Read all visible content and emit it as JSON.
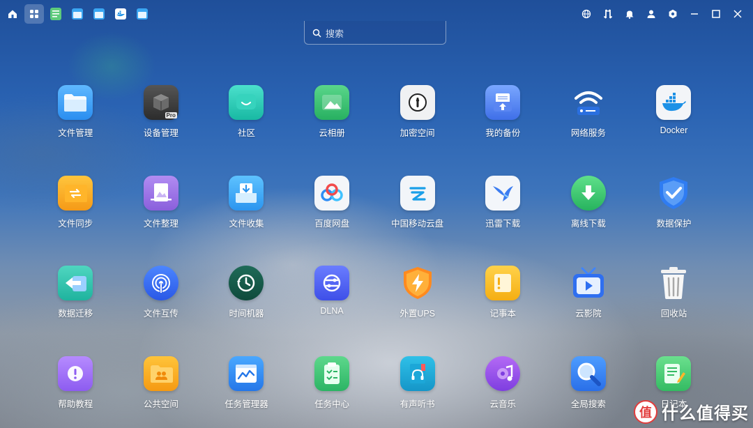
{
  "topbar": {
    "left_icons": [
      "home-icon",
      "apps-grid-icon",
      "notepad-icon",
      "window-icon",
      "window-icon",
      "docker-icon",
      "window-icon"
    ],
    "right_icons": [
      "globe-icon",
      "transfer-icon",
      "bell-icon",
      "user-icon",
      "settings-icon",
      "minimize-icon",
      "maximize-icon",
      "close-icon"
    ]
  },
  "search": {
    "placeholder": "搜索"
  },
  "apps": [
    {
      "label": "文件管理"
    },
    {
      "label": "设备管理"
    },
    {
      "label": "社区"
    },
    {
      "label": "云相册"
    },
    {
      "label": "加密空间"
    },
    {
      "label": "我的备份"
    },
    {
      "label": "网络服务"
    },
    {
      "label": "Docker"
    },
    {
      "label": "文件同步"
    },
    {
      "label": "文件整理"
    },
    {
      "label": "文件收集"
    },
    {
      "label": "百度网盘"
    },
    {
      "label": "中国移动云盘"
    },
    {
      "label": "迅雷下载"
    },
    {
      "label": "离线下载"
    },
    {
      "label": "数据保护"
    },
    {
      "label": "数据迁移"
    },
    {
      "label": "文件互传"
    },
    {
      "label": "时间机器"
    },
    {
      "label": "DLNA"
    },
    {
      "label": "外置UPS"
    },
    {
      "label": "记事本"
    },
    {
      "label": "云影院"
    },
    {
      "label": "回收站"
    },
    {
      "label": "帮助教程"
    },
    {
      "label": "公共空间"
    },
    {
      "label": "任务管理器"
    },
    {
      "label": "任务中心"
    },
    {
      "label": "有声听书"
    },
    {
      "label": "云音乐"
    },
    {
      "label": "全局搜索"
    },
    {
      "label": "日记本"
    }
  ],
  "device_badge": "Pro",
  "watermark": {
    "logo": "值",
    "text": "什么值得买"
  }
}
